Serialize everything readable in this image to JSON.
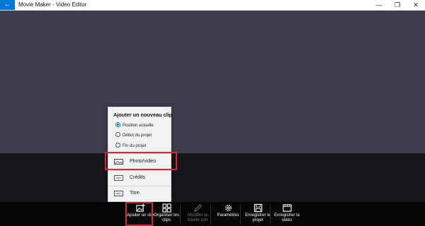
{
  "window": {
    "title": "Movie Maker - Video Editor",
    "back_glyph": "←",
    "min_glyph": "—",
    "max_glyph": "❐",
    "close_glyph": "✕"
  },
  "popup": {
    "title": "Ajouter un nouveau clip",
    "positions": [
      "Position actuelle",
      "Début du projet",
      "Fin du projet"
    ],
    "selected_position": "Position actuelle",
    "options": [
      {
        "label": "Photo/vidéo",
        "icon": "photo-icon"
      },
      {
        "label": "Crédits",
        "icon": "credits-icon",
        "icon_text": "abc"
      },
      {
        "label": "Titre",
        "icon": "title-icon",
        "icon_text": "abc"
      }
    ]
  },
  "toolbar": {
    "add_clip": "Ajouter un clip",
    "arrange_clips": "Organiser les clips",
    "edit_soundtrack": "Modifier la bande son",
    "settings": "Paramètres",
    "save_project": "Enregistrer le projet",
    "save_video": "Enregistrer la vidéo"
  },
  "colors": {
    "accent": "#0078d7",
    "highlight": "#e0262b",
    "preview_bg": "#3c3c4c",
    "toolbar_bg": "#060606"
  }
}
